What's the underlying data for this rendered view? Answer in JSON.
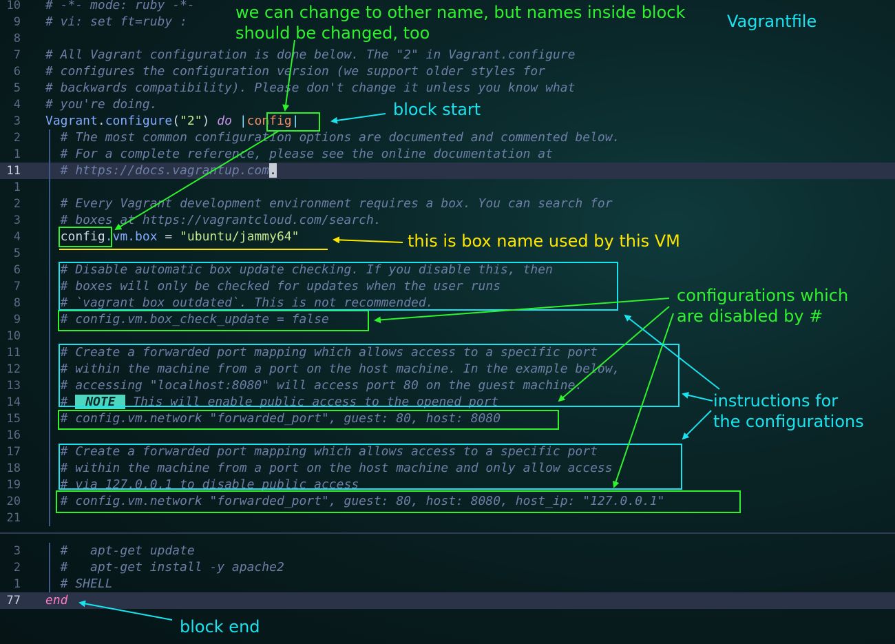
{
  "editor": {
    "file_label": "Vagrantfile",
    "lines": [
      {
        "num": "10",
        "segs": [
          {
            "t": "# -*- mode: ruby -*-",
            "c": "cm"
          }
        ]
      },
      {
        "num": "9",
        "segs": [
          {
            "t": "# vi: set ft=ruby :",
            "c": "cm"
          }
        ]
      },
      {
        "num": "8",
        "segs": []
      },
      {
        "num": "7",
        "segs": [
          {
            "t": "# All Vagrant configuration is done below. The \"2\" in Vagrant.configure",
            "c": "cm"
          }
        ]
      },
      {
        "num": "6",
        "segs": [
          {
            "t": "# configures the configuration version (we support older styles for",
            "c": "cm"
          }
        ]
      },
      {
        "num": "5",
        "segs": [
          {
            "t": "# backwards compatibility). Please don't change it unless you know what",
            "c": "cm"
          }
        ]
      },
      {
        "num": "4",
        "segs": [
          {
            "t": "# you're doing.",
            "c": "cm"
          }
        ]
      },
      {
        "num": "3",
        "segs": [
          {
            "t": "Vagrant",
            "c": "cls"
          },
          {
            "t": ".",
            "c": "plain"
          },
          {
            "t": "configure",
            "c": "cls"
          },
          {
            "t": "(",
            "c": "plain"
          },
          {
            "t": "\"2\"",
            "c": "str"
          },
          {
            "t": ") ",
            "c": "plain"
          },
          {
            "t": "do",
            "c": "kw"
          },
          {
            "t": " |",
            "c": "pipe"
          },
          {
            "t": "config",
            "c": "var"
          },
          {
            "t": "|",
            "c": "pipe"
          }
        ]
      },
      {
        "num": "2",
        "segs": [
          {
            "t": "  # The most common configuration options are documented and commented below.",
            "c": "cm"
          }
        ]
      },
      {
        "num": "1",
        "segs": [
          {
            "t": "  # For a complete reference, please see the online documentation at",
            "c": "cm"
          }
        ]
      },
      {
        "num": "11",
        "current": true,
        "segs": [
          {
            "t": "  # https://docs.vagrantup.com",
            "c": "cm"
          },
          {
            "t": ".",
            "c": "cursor-block"
          }
        ]
      },
      {
        "num": "1",
        "segs": []
      },
      {
        "num": "2",
        "segs": [
          {
            "t": "  # Every Vagrant development environment requires a box. You can search for",
            "c": "cm"
          }
        ]
      },
      {
        "num": "3",
        "segs": [
          {
            "t": "  # boxes at https://vagrantcloud.com/search.",
            "c": "cm"
          }
        ]
      },
      {
        "num": "4",
        "segs": [
          {
            "t": "  config",
            "c": "plain"
          },
          {
            "t": ".vm.box",
            "c": "cls"
          },
          {
            "t": " = ",
            "c": "plain"
          },
          {
            "t": "\"ubuntu/jammy64\"",
            "c": "str"
          }
        ]
      },
      {
        "num": "5",
        "segs": []
      },
      {
        "num": "6",
        "segs": [
          {
            "t": "  # Disable automatic box update checking. If you disable this, then",
            "c": "cm"
          }
        ]
      },
      {
        "num": "7",
        "segs": [
          {
            "t": "  # boxes will only be checked for updates when the user runs",
            "c": "cm"
          }
        ]
      },
      {
        "num": "8",
        "segs": [
          {
            "t": "  # `vagrant box outdated`. This is not recommended.",
            "c": "cm"
          }
        ]
      },
      {
        "num": "9",
        "segs": [
          {
            "t": "  # config.vm.box_check_update = false",
            "c": "cm"
          }
        ]
      },
      {
        "num": "10",
        "segs": []
      },
      {
        "num": "11",
        "segs": [
          {
            "t": "  # Create a forwarded port mapping which allows access to a specific port",
            "c": "cm"
          }
        ]
      },
      {
        "num": "12",
        "segs": [
          {
            "t": "  # within the machine from a port on the host machine. In the example below,",
            "c": "cm"
          }
        ]
      },
      {
        "num": "13",
        "segs": [
          {
            "t": "  # accessing \"localhost:8080\" will access port 80 on the guest machine.",
            "c": "cm"
          }
        ]
      },
      {
        "num": "14",
        "segs": [
          {
            "t": "  # ",
            "c": "cm"
          },
          {
            "t": " NOTE ",
            "c": "note-badge"
          },
          {
            "t": " This will enable public access to the opened port",
            "c": "cm"
          }
        ]
      },
      {
        "num": "15",
        "segs": [
          {
            "t": "  # config.vm.network \"forwarded_port\", guest: 80, host: 8080",
            "c": "cm"
          }
        ]
      },
      {
        "num": "16",
        "segs": []
      },
      {
        "num": "17",
        "segs": [
          {
            "t": "  # Create a forwarded port mapping which allows access to a specific port",
            "c": "cm"
          }
        ]
      },
      {
        "num": "18",
        "segs": [
          {
            "t": "  # within the machine from a port on the host machine and only allow access",
            "c": "cm"
          }
        ]
      },
      {
        "num": "19",
        "segs": [
          {
            "t": "  # via 127.0.0.1 to disable public access",
            "c": "cm"
          }
        ]
      },
      {
        "num": "20",
        "segs": [
          {
            "t": "  # config.vm.network \"forwarded_port\", guest: 80, host: 8080, host_ip: \"127.0.0.1\"",
            "c": "cm"
          }
        ]
      },
      {
        "num": "21",
        "segs": []
      }
    ],
    "bottom_lines": [
      {
        "num": "3",
        "segs": [
          {
            "t": "  #   apt-get update",
            "c": "cm"
          }
        ]
      },
      {
        "num": "2",
        "segs": [
          {
            "t": "  #   apt-get install -y apache2",
            "c": "cm"
          }
        ]
      },
      {
        "num": "1",
        "segs": [
          {
            "t": "  # SHELL",
            "c": "cm"
          }
        ]
      },
      {
        "num": "77",
        "current": true,
        "segs": [
          {
            "t": "end",
            "c": "end-kw"
          }
        ]
      }
    ]
  },
  "annotations": {
    "block_name_note_line1": "we can change to other name, but names inside block",
    "block_name_note_line2": "should be changed, too",
    "block_start": "block start",
    "box_name": "this is box name used by this VM",
    "disabled_configs_line1": "configurations which",
    "disabled_configs_line2": "are disabled by #",
    "instructions_line1": "instructions for",
    "instructions_line2": "the configurations",
    "block_end": "block end"
  },
  "colors": {
    "annotation_green": "#2ef22e",
    "annotation_cyan": "#18e3ee",
    "annotation_yellow": "#ffe600"
  }
}
